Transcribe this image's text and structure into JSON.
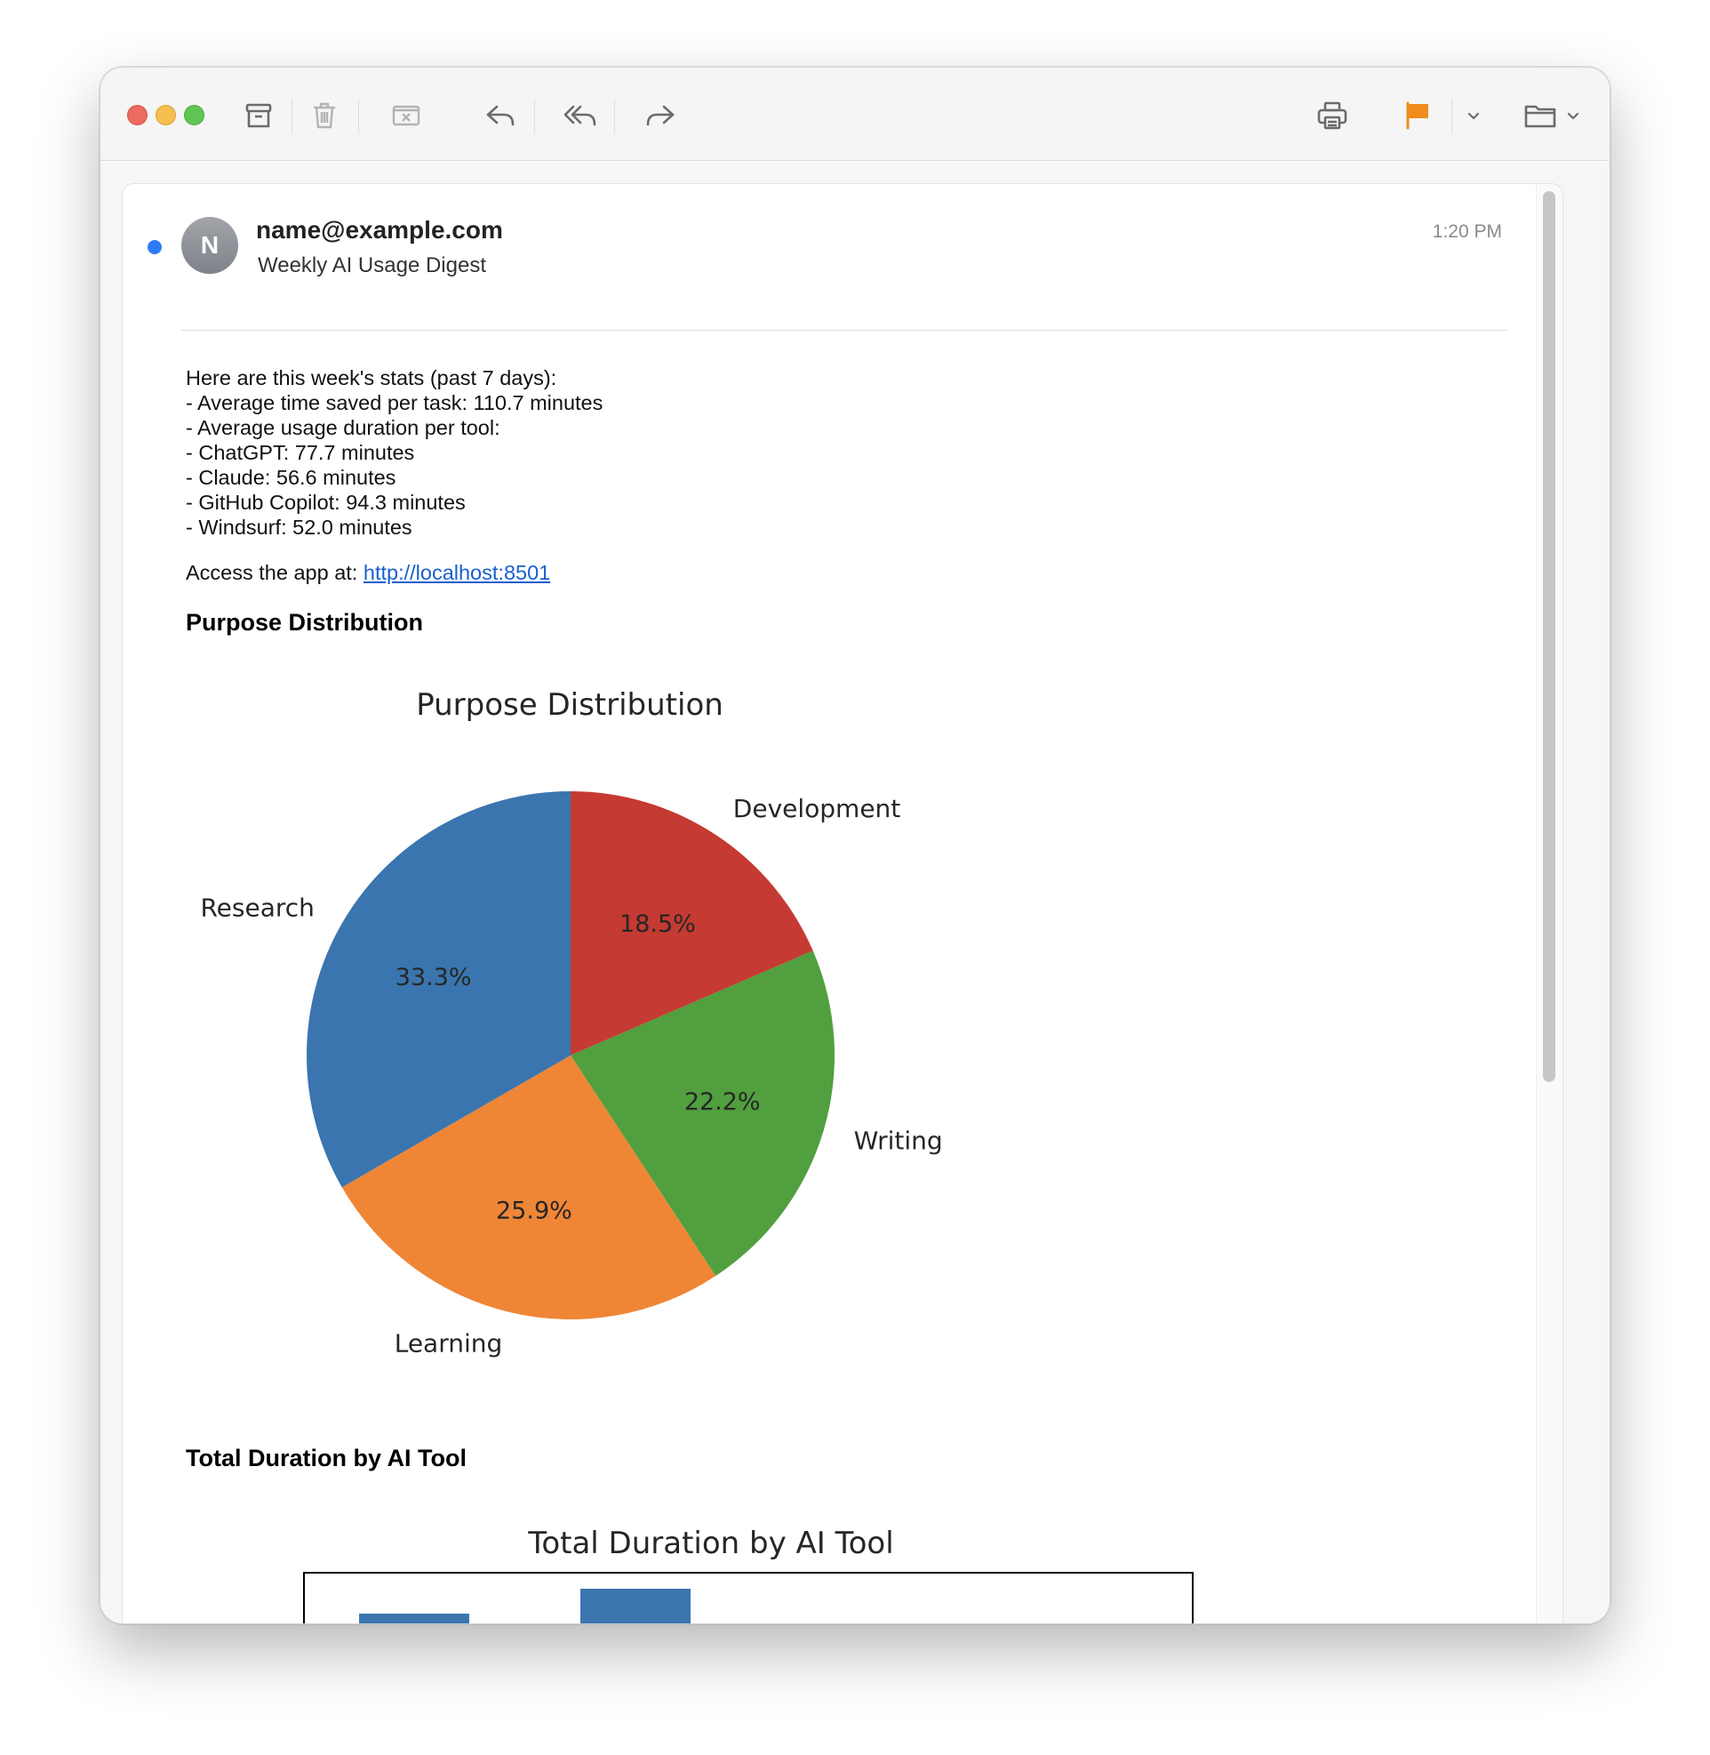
{
  "toolbar": {
    "icons": [
      "archive-icon",
      "trash-icon",
      "junk-icon",
      "reply-icon",
      "reply-all-icon",
      "forward-icon",
      "print-icon",
      "flag-icon",
      "chevron-down-icon",
      "folder-icon"
    ],
    "flag_color": "#f08c1e"
  },
  "message": {
    "avatar_initial": "N",
    "sender": "name@example.com",
    "subject": "Weekly AI Usage Digest",
    "time": "1:20 PM",
    "body_lines": [
      "Here are this week's stats (past 7 days):",
      "- Average time saved per task: 110.7 minutes",
      "- Average usage duration per tool:",
      "- ChatGPT: 77.7 minutes",
      "- Claude: 56.6 minutes",
      "- GitHub Copilot: 94.3 minutes",
      "- Windsurf: 52.0 minutes"
    ],
    "access_prefix": "Access the app at: ",
    "access_link": "http://localhost:8501",
    "section_1_heading": "Purpose Distribution",
    "section_2_heading": "Total Duration by AI Tool"
  },
  "chart_data": [
    {
      "type": "pie",
      "title": "Purpose Distribution",
      "labels": [
        "Development",
        "Writing",
        "Learning",
        "Research"
      ],
      "values": [
        18.5,
        22.2,
        25.9,
        33.3
      ],
      "value_labels": [
        "18.5%",
        "22.2%",
        "25.9%",
        "33.3%"
      ],
      "colors": [
        "#c53a32",
        "#519f3e",
        "#ef8636",
        "#3b75af"
      ],
      "start_angle": "90 (12 o'clock), clockwise"
    },
    {
      "type": "bar",
      "title": "Total Duration by AI Tool",
      "bar_color": "#3b75af",
      "note": "only the top of the chart is visible; values not readable"
    }
  ]
}
